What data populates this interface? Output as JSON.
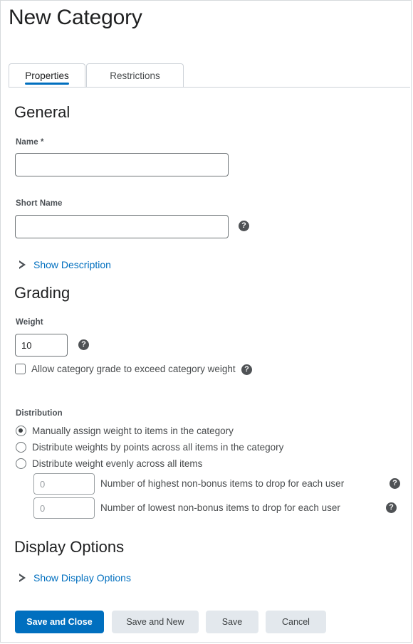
{
  "header": {
    "title": "New Category"
  },
  "tabs": [
    {
      "label": "Properties",
      "active": true
    },
    {
      "label": "Restrictions",
      "active": false
    }
  ],
  "sections": {
    "general": {
      "title": "General",
      "name": {
        "label": "Name",
        "required_marker": "*",
        "value": "",
        "placeholder": ""
      },
      "short_name": {
        "label": "Short Name",
        "value": "",
        "placeholder": ""
      },
      "show_description": "Show Description"
    },
    "grading": {
      "title": "Grading",
      "weight": {
        "label": "Weight",
        "value": "10"
      },
      "allow_exceed": {
        "label": "Allow category grade to exceed category weight",
        "checked": false
      },
      "distribution": {
        "label": "Distribution",
        "options": [
          {
            "label": "Manually assign weight to items in the category",
            "selected": true
          },
          {
            "label": "Distribute weights by points across all items in the category",
            "selected": false
          },
          {
            "label": "Distribute weight evenly across all items",
            "selected": false
          }
        ],
        "drop_highest": {
          "value": "",
          "placeholder": "0",
          "label": "Number of highest non-bonus items to drop for each user"
        },
        "drop_lowest": {
          "value": "",
          "placeholder": "0",
          "label": "Number of lowest non-bonus items to drop for each user"
        }
      }
    },
    "display_options": {
      "title": "Display Options",
      "show_display_options": "Show Display Options"
    }
  },
  "footer": {
    "buttons": [
      {
        "label": "Save and Close",
        "style": "primary"
      },
      {
        "label": "Save and New",
        "style": "secondary"
      },
      {
        "label": "Save",
        "style": "secondary"
      },
      {
        "label": "Cancel",
        "style": "secondary"
      }
    ]
  },
  "icons": {
    "help": "help-circle-icon",
    "expand": "triangle-right-icon"
  },
  "colors": {
    "accent": "#006fbf",
    "link": "#006fbf",
    "text": "#202122",
    "muted": "#494c4e",
    "border": "#cdd2d8"
  }
}
